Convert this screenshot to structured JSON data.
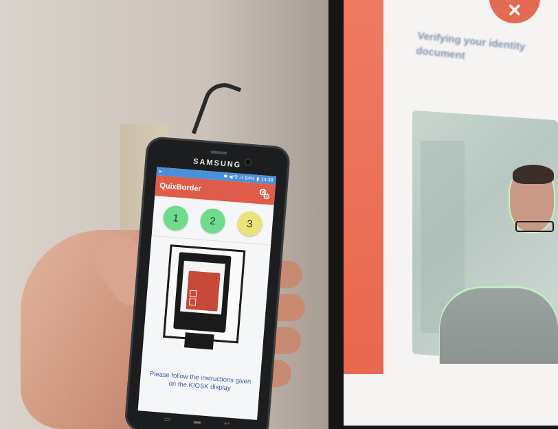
{
  "phone": {
    "brand": "SAMSUNG",
    "status_bar": {
      "left": "▸",
      "signal_text": "✱ ◀ ⅋ .ıl",
      "battery": "84%",
      "time": "14:38"
    },
    "app": {
      "title": "QuixBorder",
      "settings_icon": "gears-icon",
      "accent_color": "#df5c4a",
      "steps": [
        {
          "label": "1",
          "state": "done"
        },
        {
          "label": "2",
          "state": "done"
        },
        {
          "label": "3",
          "state": "pending"
        }
      ],
      "instruction_line1": "Please follow the instructions given",
      "instruction_line2": "on the KIOSK display"
    }
  },
  "kiosk": {
    "text_line1": "Verifying your identity",
    "text_line2": "document",
    "logo_glyph": "✕",
    "accent_color": "#e8674f"
  }
}
